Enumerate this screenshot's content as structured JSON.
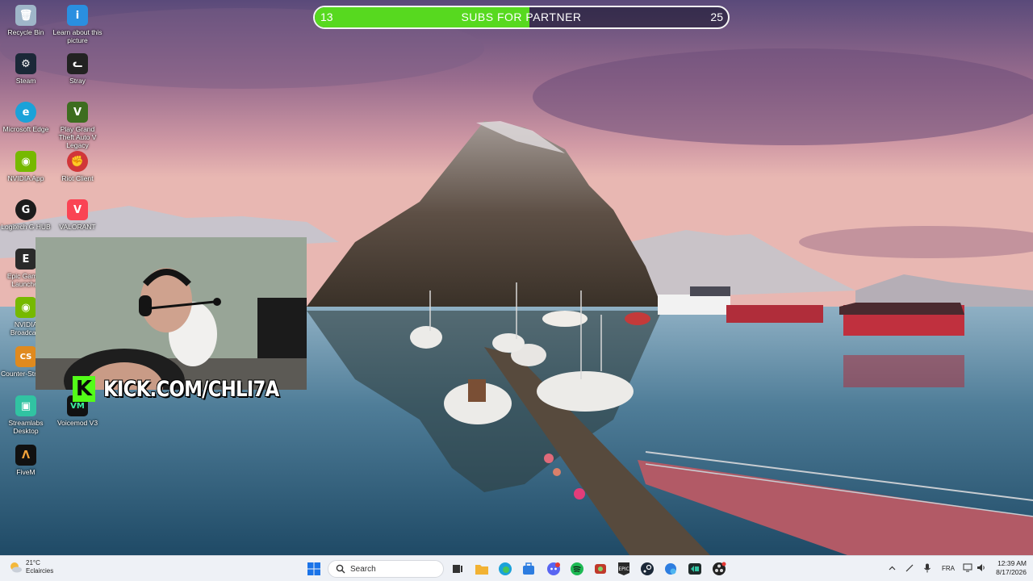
{
  "goal": {
    "current": "13",
    "label": "SUBS FOR PARTNER",
    "target": "25",
    "progress": 0.52
  },
  "desktop_icons": [
    {
      "label": "Recycle Bin",
      "icon": "recycle-bin-icon",
      "glyph": "🗑",
      "color": "#9fb6c9"
    },
    {
      "label": "Learn about this picture",
      "icon": "info-icon",
      "glyph": "i",
      "color": "#2a8fe0"
    },
    {
      "label": "Steam",
      "icon": "steam-icon",
      "glyph": "⚙",
      "color": "#1b2838"
    },
    {
      "label": "Stray",
      "icon": "cat-icon",
      "glyph": "🐱",
      "color": "#222222"
    },
    {
      "label": "Microsoft Edge",
      "icon": "edge-icon",
      "glyph": "e",
      "color": "#1aa2d9"
    },
    {
      "label": "Play Grand Theft Auto V Legacy",
      "icon": "gta-icon",
      "glyph": "V",
      "color": "#3d6d1f"
    },
    {
      "label": "NVIDIA App",
      "icon": "nvidia-icon",
      "glyph": "◉",
      "color": "#76b900"
    },
    {
      "label": "Riot Client",
      "icon": "riot-icon",
      "glyph": "✊",
      "color": "#d13639"
    },
    {
      "label": "Logitech G HUB",
      "icon": "logitech-icon",
      "glyph": "G",
      "color": "#1c1c1c"
    },
    {
      "label": "VALORANT",
      "icon": "valorant-icon",
      "glyph": "V",
      "color": "#fa4454"
    },
    {
      "label": "Epic Games Launcher",
      "icon": "epic-icon",
      "glyph": "E",
      "color": "#2a2a2a"
    },
    {
      "label": "NVIDIA Broadcast",
      "icon": "nvidia-broadcast-icon",
      "glyph": "◉",
      "color": "#76b900"
    },
    {
      "label": "Counter-Strike 2",
      "icon": "counter-strike-icon",
      "glyph": "CS",
      "color": "#e08a1e"
    },
    {
      "label": "Streamlabs Desktop",
      "icon": "streamlabs-icon",
      "glyph": "▣",
      "color": "#31c3a2"
    },
    {
      "label": "Voicemod V3",
      "icon": "voicemod-icon",
      "glyph": "VM",
      "color": "#111111"
    },
    {
      "label": "FiveM",
      "icon": "fivem-icon",
      "glyph": "Λ",
      "color": "#111111"
    }
  ],
  "overlay": {
    "kick_letter": "K",
    "kick_url": "KICK.COM/CHLI7A"
  },
  "taskbar": {
    "temperature": "21°C",
    "condition": "Eclaircies",
    "search_placeholder": "Search",
    "apps": [
      {
        "name": "start-icon",
        "color": "#1a73e8"
      },
      {
        "name": "task-view-icon",
        "color": "#333333"
      },
      {
        "name": "file-explorer-icon",
        "color": "#f2b233"
      },
      {
        "name": "edge-icon",
        "color": "#1aa2d9"
      },
      {
        "name": "store-icon",
        "color": "#2d7de0"
      },
      {
        "name": "discord-icon",
        "color": "#5865f2"
      },
      {
        "name": "spotify-icon",
        "color": "#1db954"
      },
      {
        "name": "game-icon",
        "color": "#c0392b"
      },
      {
        "name": "epic-icon",
        "color": "#2a2a2a"
      },
      {
        "name": "steam-icon",
        "color": "#1b2838"
      },
      {
        "name": "app-icon",
        "color": "#2d7de0"
      },
      {
        "name": "streamlabs-icon",
        "color": "#31c3a2"
      },
      {
        "name": "obs-icon",
        "color": "#222222"
      }
    ],
    "language": "FRA",
    "time": "12:39 AM",
    "date": "8/17/2026"
  }
}
